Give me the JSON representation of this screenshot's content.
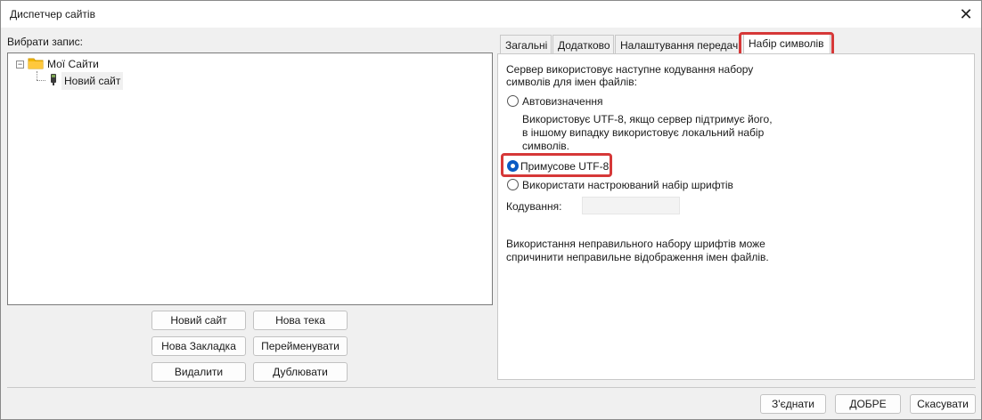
{
  "window": {
    "title": "Диспетчер сайтів"
  },
  "left": {
    "select_label": "Вибрати запис:",
    "tree": {
      "root": {
        "label": "Мої Сайти",
        "toggle": "−"
      },
      "child": {
        "label": "Новий сайт"
      }
    },
    "buttons": {
      "new_site": "Новий сайт",
      "new_folder": "Нова тека",
      "new_bookmark": "Нова Закладка",
      "rename": "Перейменувати",
      "delete": "Видалити",
      "duplicate": "Дублювати"
    }
  },
  "tabs": [
    {
      "label": "Загальні"
    },
    {
      "label": "Додатково"
    },
    {
      "label": "Налаштування передачі"
    },
    {
      "label": "Набір символів",
      "active": true
    }
  ],
  "charset": {
    "description_line1": "Сервер використовує наступне кодування набору",
    "description_line2": "символів для імен файлів:",
    "option_auto": "Автовизначення",
    "auto_note_line1": "Використовує UTF-8, якщо сервер підтримує його,",
    "auto_note_line2": "в іншому випадку використовує локальний набір",
    "auto_note_line3": "символів.",
    "option_force_utf8": "Примусове UTF-8",
    "option_custom": "Використати настроюваний набір шрифтів",
    "encoding_label": "Кодування:",
    "encoding_value": "",
    "warning_line1": "Використання неправильного набору шрифтів може",
    "warning_line2": "спричинити неправильне відображення імен файлів.",
    "selected": "force_utf8"
  },
  "footer": {
    "connect": "З'єднати",
    "ok": "ДОБРЕ",
    "cancel": "Скасувати"
  },
  "colors": {
    "highlight": "#d63838",
    "radio_selected": "#0a5bc4"
  },
  "icons": {
    "close": "close-icon",
    "folder": "folder-icon",
    "site": "site-icon"
  }
}
